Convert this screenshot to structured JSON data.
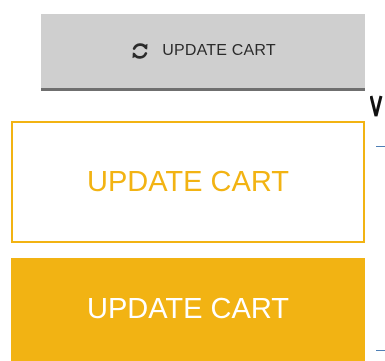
{
  "buttons": {
    "grey": {
      "label": "UPDATE CART",
      "icon": "refresh-icon"
    },
    "outline": {
      "label": "UPDATE CART"
    },
    "solid": {
      "label": "UPDATE CART"
    }
  },
  "colors": {
    "accent": "#f2b313",
    "grey_bg": "#cfcfcf",
    "grey_border": "#6f6f6f",
    "grey_text": "#2b2b2b",
    "white": "#ffffff"
  }
}
